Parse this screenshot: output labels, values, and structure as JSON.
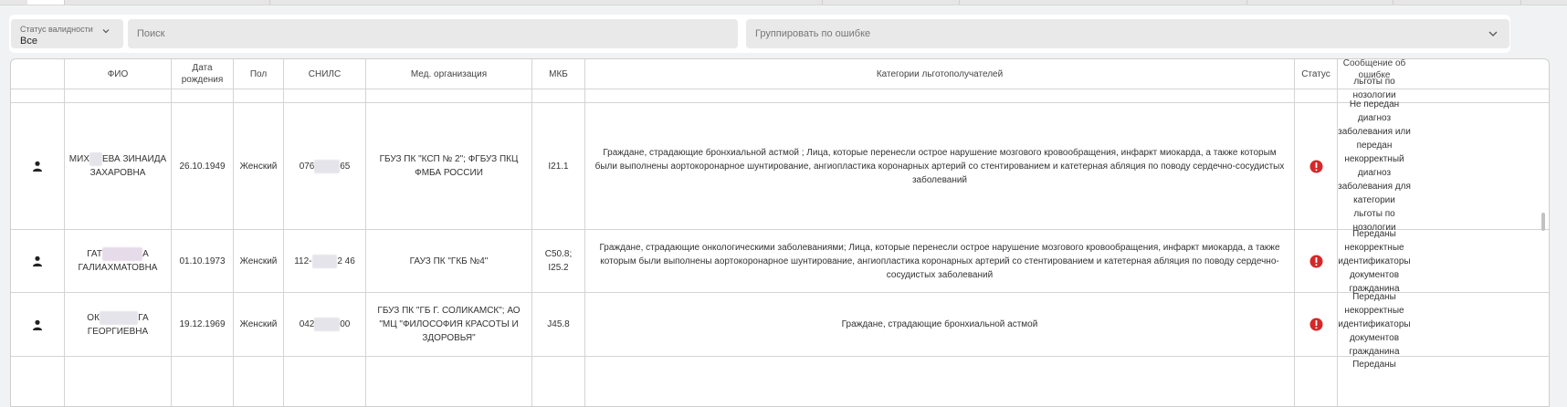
{
  "filters": {
    "status_label": "Статус валидности",
    "status_value": "Все",
    "search_placeholder": "Поиск",
    "group_placeholder": "Группировать по ошибке"
  },
  "columns": [
    "ФИО",
    "Дата рождения",
    "Пол",
    "СНИЛС",
    "Мед. организация",
    "МКБ",
    "Категории льготополучателей",
    "Статус",
    "Сообщение об ошибке"
  ],
  "partial_top_message": "льготы по нозологии",
  "rows": [
    {
      "fio_a": "МИХ",
      "fio_b": "ЕВА ЗИНАИДА",
      "fio_2": "ЗАХАРОВНА",
      "dob": "26.10.1949",
      "sex": "Женский",
      "snils_a": "076",
      "snils_b": "65",
      "org": "ГБУЗ ПК \"КСП № 2\"; ФГБУЗ ПКЦ ФМБА РОССИИ",
      "mkb": "I21.1",
      "categories": "Граждане, страдающие бронхиальной астмой ; Лица, которые перенесли острое нарушение мозгового кровообращения, инфаркт миокарда, а также которым были выполнены аортокоронарное шунтирование, ангиопластика коронарных артерий со стентированием и катетерная абляция по поводу сердечно-сосудистых заболеваний",
      "message": "Не передан диагноз заболевания или передан некорректный диагноз заболевания для категории льготы по нозологии"
    },
    {
      "fio_a": "ГАТ",
      "fio_b": "А",
      "fio_2": "ГАЛИАХМАТОВНА",
      "dob": "01.10.1973",
      "sex": "Женский",
      "snils_a": "112-",
      "snils_b": "2 46",
      "org": "ГАУЗ ПК \"ГКБ №4\"",
      "mkb": "C50.8; I25.2",
      "categories": "Граждане, страдающие онкологическими заболеваниями; Лица, которые перенесли острое нарушение мозгового кровообращения, инфаркт миокарда, а также которым были выполнены аортокоронарное шунтирование, ангиопластика коронарных артерий со стентированием и катетерная абляция по поводу сердечно-сосудистых заболеваний",
      "message": "Переданы некорректные идентификаторы документов гражданина"
    },
    {
      "fio_a": "ОК",
      "fio_b": "ГА",
      "fio_2": "ГЕОРГИЕВНА",
      "dob": "19.12.1969",
      "sex": "Женский",
      "snils_a": "042",
      "snils_b": "00",
      "org": "ГБУЗ ПК \"ГБ Г. СОЛИКАМСК\"; АО \"МЦ \"ФИЛОСОФИЯ КРАСОТЫ И ЗДОРОВЬЯ\"",
      "mkb": "J45.8",
      "categories": "Граждане, страдающие бронхиальной астмой",
      "message": "Переданы некорректные идентификаторы документов гражданина"
    }
  ],
  "partial_bottom_message": "Переданы",
  "icons": {
    "person": "person-icon",
    "status": "error-status-icon",
    "chevron": "chevron-down-icon"
  },
  "colors": {
    "error": "#d62828",
    "background": "#f1f2f3",
    "field": "#e9e9e9"
  }
}
